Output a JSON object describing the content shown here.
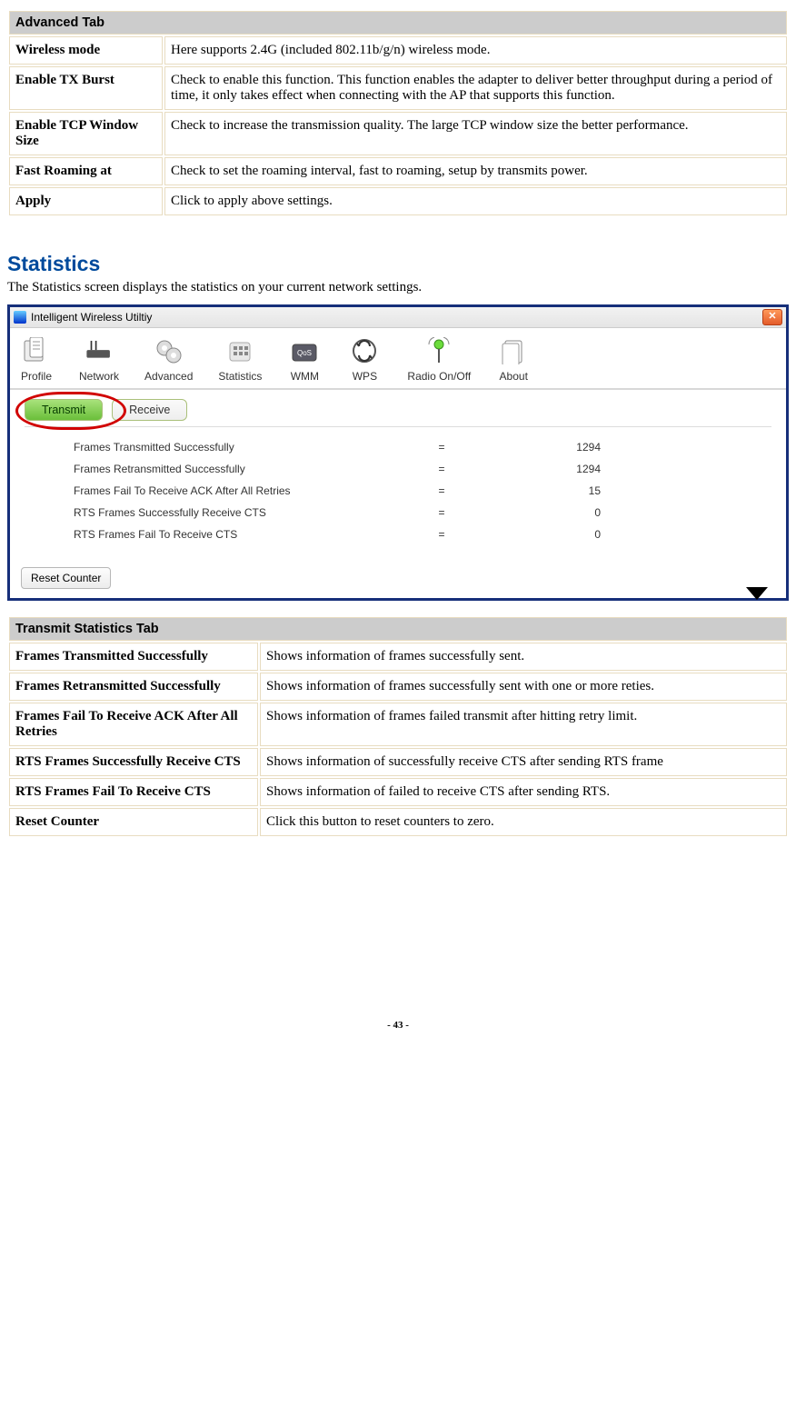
{
  "advanced_tab": {
    "header": "Advanced Tab",
    "rows": [
      {
        "label": "Wireless mode",
        "desc": "Here supports 2.4G (included 802.11b/g/n) wireless mode."
      },
      {
        "label": "Enable TX Burst",
        "desc": "Check to enable this function. This function enables the adapter to deliver better throughput during a period of time, it only takes effect when connecting with the AP that supports this function."
      },
      {
        "label": "Enable TCP Window Size",
        "desc": "Check to increase the transmission quality. The large TCP window size the better performance."
      },
      {
        "label": "Fast Roaming at",
        "desc": "Check to set the roaming interval, fast to roaming, setup by transmits power."
      },
      {
        "label": "Apply",
        "desc": "Click to apply above settings."
      }
    ]
  },
  "statistics_section": {
    "title": "Statistics",
    "intro": "The Statistics screen displays the statistics on your current network settings."
  },
  "screenshot": {
    "window_title": "Intelligent Wireless Utiltiy",
    "toolbar": [
      "Profile",
      "Network",
      "Advanced",
      "Statistics",
      "WMM",
      "WPS",
      "Radio On/Off",
      "About"
    ],
    "sub_tabs": {
      "active": "Transmit",
      "other": "Receive"
    },
    "rows": [
      {
        "label": "Frames Transmitted Successfully",
        "value": "1294"
      },
      {
        "label": "Frames Retransmitted Successfully",
        "value": "1294"
      },
      {
        "label": "Frames Fail To Receive ACK After All Retries",
        "value": "15"
      },
      {
        "label": "RTS Frames Successfully Receive CTS",
        "value": "0"
      },
      {
        "label": "RTS Frames Fail To Receive CTS",
        "value": "0"
      }
    ],
    "reset_button": "Reset Counter"
  },
  "transmit_tab": {
    "header": "Transmit Statistics Tab",
    "rows": [
      {
        "label": "Frames Transmitted Successfully",
        "desc": "Shows information of frames successfully sent."
      },
      {
        "label": "Frames Retransmitted Successfully",
        "desc": "Shows information of frames successfully sent with one or more reties."
      },
      {
        "label": "Frames Fail To Receive ACK After All Retries",
        "desc": "Shows information of frames failed transmit after hitting retry limit."
      },
      {
        "label": "RTS Frames Successfully Receive CTS",
        "desc": "Shows information of successfully receive CTS after sending RTS frame"
      },
      {
        "label": "RTS Frames Fail To Receive CTS",
        "desc": "Shows information of failed to receive CTS after sending RTS."
      },
      {
        "label": "Reset Counter",
        "desc": "Click this button to reset counters to zero."
      }
    ]
  },
  "page_number": "- 43 -"
}
